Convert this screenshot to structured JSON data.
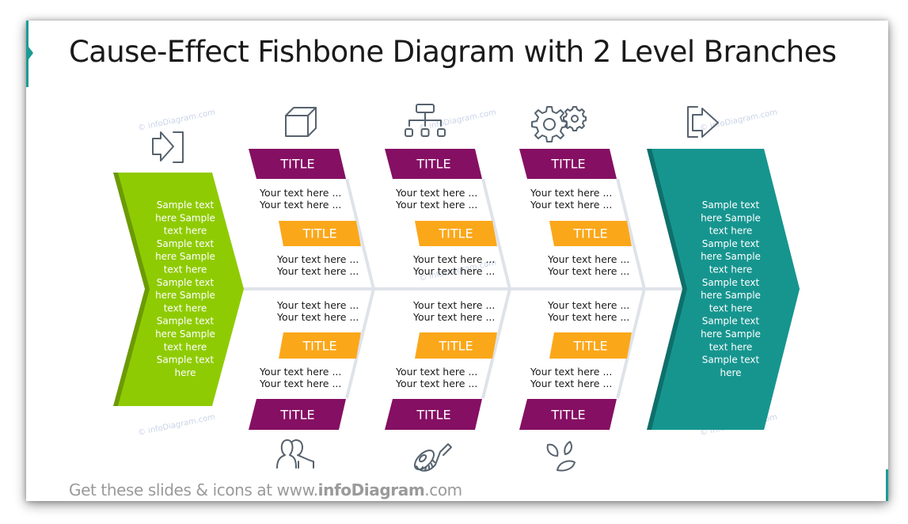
{
  "slide": {
    "title": "Cause-Effect Fishbone Diagram with 2 Level Branches",
    "footer_prefix": "Get these slides & icons at www.",
    "footer_brand": "infoDiagram",
    "footer_suffix": ".com",
    "watermark": "© infoDiagram.com"
  },
  "colors": {
    "cause_arrow": "#8fcb02",
    "cause_arrow_shade": "#6c9a05",
    "effect_arrow": "#16958f",
    "effect_arrow_shade": "#0f6f6a",
    "primary_tag": "#850f63",
    "secondary_tag": "#fba71a",
    "spine": "#dfe3e9",
    "icon_stroke": "#56626e",
    "accent": "#1a9b94"
  },
  "cause": {
    "icon": "enter-arrow-icon",
    "lines": [
      "Sample text",
      "here Sample",
      "text here",
      "Sample text",
      "here Sample",
      "text here",
      "Sample text",
      "here Sample",
      "text here",
      "Sample text",
      "here Sample",
      "text here",
      "Sample text",
      "here"
    ]
  },
  "effect": {
    "icon": "exit-arrow-icon",
    "lines": [
      "Sample text",
      "here Sample",
      "text here",
      "Sample text",
      "here Sample",
      "text here",
      "Sample text",
      "here Sample",
      "text here",
      "Sample text",
      "here Sample",
      "text here",
      "Sample text",
      "here"
    ]
  },
  "top_branches": [
    {
      "icon": "cube-icon",
      "title": "TITLE",
      "text1": [
        "Your text here ...",
        "Your text here ..."
      ],
      "subtitle": "TITLE",
      "text2": [
        "Your text here ...",
        "Your text here ..."
      ]
    },
    {
      "icon": "org-chart-icon",
      "title": "TITLE",
      "text1": [
        "Your text here ...",
        "Your text here ..."
      ],
      "subtitle": "TITLE",
      "text2": [
        "Your text here ...",
        "Your text here ..."
      ]
    },
    {
      "icon": "gears-icon",
      "title": "TITLE",
      "text1": [
        "Your text here ...",
        "Your text here ..."
      ],
      "subtitle": "TITLE",
      "text2": [
        "Your text here ...",
        "Your text here ..."
      ]
    }
  ],
  "bottom_branches": [
    {
      "icon": "people-icon",
      "title": "TITLE",
      "text1": [
        "Your text here ...",
        "Your text here ..."
      ],
      "subtitle": "TITLE",
      "text2": [
        "Your text here ...",
        "Your text here ..."
      ]
    },
    {
      "icon": "measuring-tape-icon",
      "title": "TITLE",
      "text1": [
        "Your text here ...",
        "Your text here ..."
      ],
      "subtitle": "TITLE",
      "text2": [
        "Your text here ...",
        "Your text here ..."
      ]
    },
    {
      "icon": "leaves-icon",
      "title": "TITLE",
      "text1": [
        "Your text here ...",
        "Your text here ..."
      ],
      "subtitle": "TITLE",
      "text2": [
        "Your text here ...",
        "Your text here ..."
      ]
    }
  ]
}
